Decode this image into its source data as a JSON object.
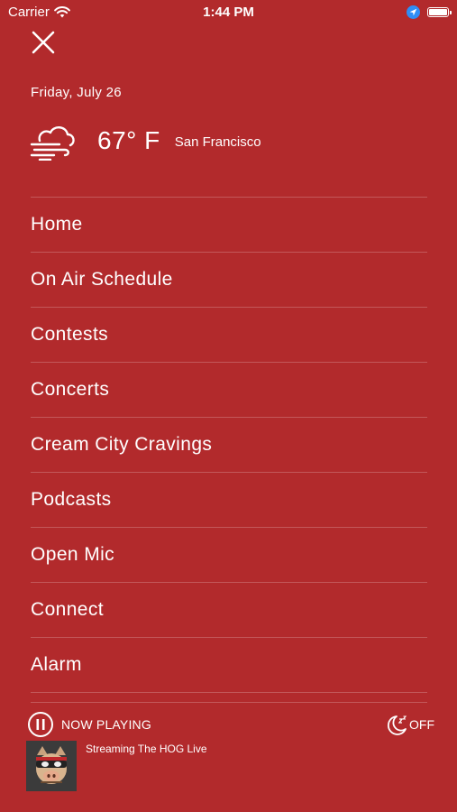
{
  "status_bar": {
    "carrier": "Carrier",
    "time": "1:44 PM",
    "icons": [
      "wifi-icon",
      "location-arrow-icon",
      "battery-icon"
    ]
  },
  "menu_header": {
    "close_icon": "close-icon",
    "date": "Friday, July 26",
    "weather": {
      "icon": "cloud-wind-icon",
      "temperature": "67° F",
      "city": "San Francisco"
    }
  },
  "menu": {
    "items": [
      {
        "label": "Home"
      },
      {
        "label": "On Air Schedule"
      },
      {
        "label": "Contests"
      },
      {
        "label": "Concerts"
      },
      {
        "label": "Cream City Cravings"
      },
      {
        "label": "Podcasts"
      },
      {
        "label": "Open Mic"
      },
      {
        "label": "Connect"
      },
      {
        "label": "Alarm"
      }
    ]
  },
  "player": {
    "pause_icon": "pause-icon",
    "now_playing_label": "NOW PLAYING",
    "sleep_timer": {
      "icon": "sleep-timer-moon-icon",
      "state": "OFF"
    },
    "track_title": "Streaming The HOG Live",
    "artwork": "hog-mascot-artwork"
  },
  "colors": {
    "background": "#b22a2c",
    "text": "#ffffff",
    "divider": "rgba(255,255,255,0.22)",
    "location_badge": "#2f8df5"
  }
}
